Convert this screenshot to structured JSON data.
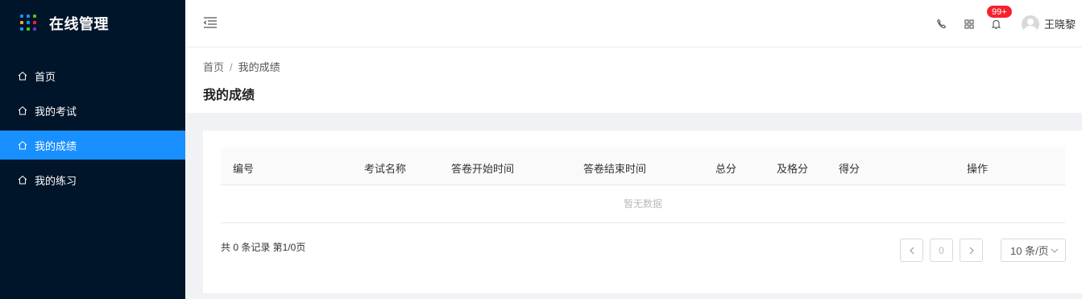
{
  "app": {
    "title": "在线管理",
    "logo_dot_colors": [
      "#1890ff",
      "#1890ff",
      "#52c41a",
      "#faad14",
      "#1890ff",
      "#f5222d",
      "#1890ff",
      "#52c41a",
      "#722ed1"
    ]
  },
  "sidebar": {
    "items": [
      {
        "label": "首页",
        "icon": "home-icon",
        "active": false
      },
      {
        "label": "我的考试",
        "icon": "home-icon",
        "active": false
      },
      {
        "label": "我的成绩",
        "icon": "home-icon",
        "active": true
      },
      {
        "label": "我的练习",
        "icon": "home-icon",
        "active": false
      }
    ],
    "active_color": "#1890ff",
    "background": "#001529"
  },
  "header": {
    "collapse_icon": "menu-fold-icon",
    "phone_icon": "phone-icon",
    "apps_icon": "apps-grid-icon",
    "bell_icon": "bell-icon",
    "badge": "99+",
    "username": "王晓黎"
  },
  "breadcrumb": {
    "home": "首页",
    "separator": "/",
    "current": "我的成绩"
  },
  "page": {
    "title": "我的成绩"
  },
  "table": {
    "columns": [
      "编号",
      "考试名称",
      "答卷开始时间",
      "答卷结束时间",
      "总分",
      "及格分",
      "得分",
      "操作"
    ],
    "rows": [],
    "empty_text": "暂无数据"
  },
  "pagination": {
    "summary": "共 0 条记录 第1/0页",
    "current_page": "0",
    "page_size": "10 条/页"
  }
}
